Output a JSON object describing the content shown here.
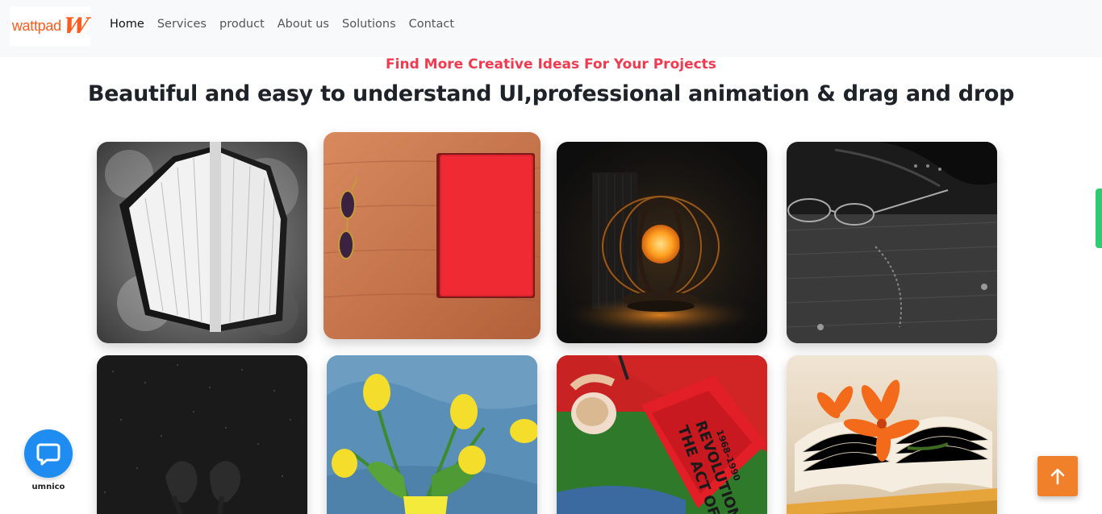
{
  "brand": {
    "logo_text": "wattpad",
    "logo_mark": "W",
    "color": "#ff5a1f"
  },
  "nav": {
    "items": [
      {
        "label": "Home",
        "active": true
      },
      {
        "label": "Services",
        "active": false
      },
      {
        "label": "product",
        "active": false
      },
      {
        "label": "About us",
        "active": false
      },
      {
        "label": "Solutions",
        "active": false
      },
      {
        "label": "Contact",
        "active": false
      }
    ]
  },
  "hero": {
    "subtitle": "Find More Creative Ideas For Your Projects",
    "headline": "Beautiful and easy to understand UI,professional animation & drag and drop"
  },
  "gallery": {
    "images": [
      {
        "subject": "open hardcover book on grey stone"
      },
      {
        "subject": "red book and glasses on wooden table"
      },
      {
        "subject": "glowing orange lamp in the dark"
      },
      {
        "subject": "eyeglasses on black jeans"
      },
      {
        "subject": "black roses on sparkling black"
      },
      {
        "subject": "yellow tulips on blue background"
      },
      {
        "subject": "person reading red book with coffee"
      },
      {
        "subject": "orange lily on open book"
      }
    ],
    "book_cover_text": [
      "THE ACT OF",
      "REVOLUTION",
      "1968–1990"
    ]
  },
  "widgets": {
    "chat_label": "umnico",
    "chat_color": "#1e8cf0",
    "scroll_top_color": "#f0812a",
    "subtitle_color": "#f03a4f"
  }
}
